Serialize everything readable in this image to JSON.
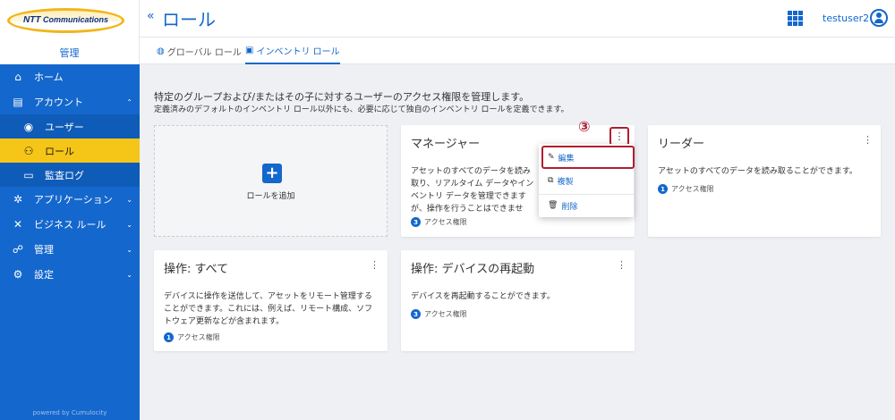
{
  "brand": {
    "logo_text": "NTT Communications",
    "logo_ntt": "NTT",
    "logo_rest": "Communications",
    "section": "管理"
  },
  "sidebar": {
    "items": [
      {
        "label": "ホーム",
        "icon": "home-icon"
      },
      {
        "label": "アカウント",
        "icon": "accounts-icon",
        "expanded": true
      },
      {
        "label": "ユーザー",
        "icon": "user-icon"
      },
      {
        "label": "ロール",
        "icon": "roles-icon",
        "active": true
      },
      {
        "label": "監査ログ",
        "icon": "audit-log-icon"
      },
      {
        "label": "アプリケーション",
        "icon": "applications-icon"
      },
      {
        "label": "ビジネス ルール",
        "icon": "business-rules-icon"
      },
      {
        "label": "管理",
        "icon": "management-icon"
      },
      {
        "label": "設定",
        "icon": "settings-icon"
      }
    ],
    "footer": "powered by Cumulocity"
  },
  "header": {
    "collapse": "«",
    "title": "ロール",
    "username": "testuser2"
  },
  "tabs": [
    {
      "label": "グローバル ロール",
      "active": false
    },
    {
      "label": "インベントリ ロール",
      "active": true
    }
  ],
  "main": {
    "description": "特定のグループおよび/またはその子に対するユーザーのアクセス権限を管理します。",
    "subdescription": "定義済みのデフォルトのインベントリ ロール以外にも、必要に応じて独自のインベントリ ロールを定義できます。",
    "add_role": "ロールを追加",
    "add_symbol": "+",
    "kebab": "⋮",
    "step_marker": "③"
  },
  "cards": [
    {
      "title": "マネージャー",
      "desc": "アセットのすべてのデータを読み取り、リアルタイム データやインベントリ データを管理できますが、操作を行うことはできません。また、アラームを認識し、イベントを作成したり、ダッシュボードを作成または更新したりすることもできます。",
      "count": "3",
      "access_label": "アクセス権限"
    },
    {
      "title": "リーダー",
      "desc": "アセットのすべてのデータを読み取ることができます。",
      "count": "1",
      "access_label": "アクセス権限"
    },
    {
      "title": "操作: すべて",
      "desc": "デバイスに操作を送信して、アセットをリモート管理することができます。これには、例えば、リモート構成、ソフトウェア更新などが含まれます。",
      "count": "1",
      "access_label": "アクセス権限"
    },
    {
      "title": "操作: デバイスの再起動",
      "desc": "デバイスを再起動することができます。",
      "count": "3",
      "access_label": "アクセス権限"
    }
  ],
  "menu": {
    "edit": "編集",
    "copy": "複製",
    "delete": "削除"
  },
  "colors": {
    "primary": "#1467cc",
    "active_nav": "#f5c518",
    "highlight": "#b01e2f"
  }
}
